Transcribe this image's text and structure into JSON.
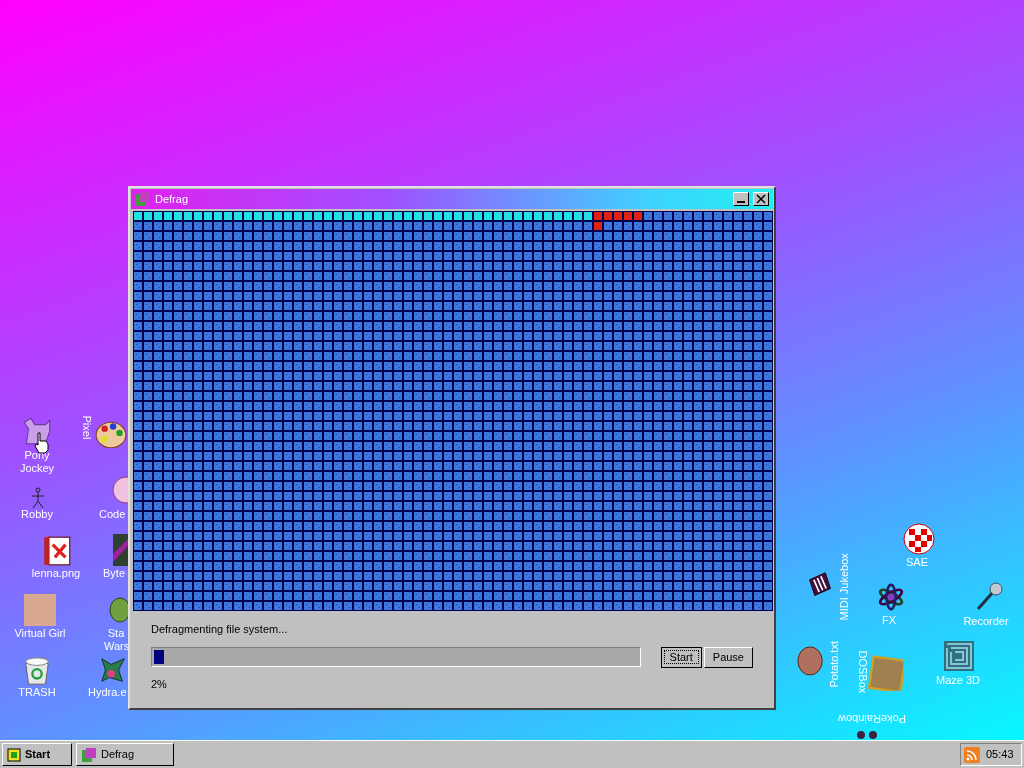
{
  "desktop_icons": [
    {
      "label": "Pony\nJockey",
      "kind": "horizontal"
    },
    {
      "label": "Pixel",
      "kind": "down"
    },
    {
      "label": "Robby",
      "kind": "horizontal"
    },
    {
      "label": "Code",
      "kind": "horizontal"
    },
    {
      "label": "lenna.png",
      "kind": "horizontal"
    },
    {
      "label": "Byte",
      "kind": "horizontal"
    },
    {
      "label": "Virtual Girl",
      "kind": "horizontal"
    },
    {
      "label": "Sta\nWars",
      "kind": "horizontal"
    },
    {
      "label": "TRASH",
      "kind": "horizontal"
    },
    {
      "label": "Hydra.e",
      "kind": "horizontal"
    },
    {
      "label": "SAE",
      "kind": "horizontal"
    },
    {
      "label": "MIDI Jukebox",
      "kind": "up"
    },
    {
      "label": "FX",
      "kind": "horizontal"
    },
    {
      "label": "Recorder",
      "kind": "horizontal"
    },
    {
      "label": "Potato.txt",
      "kind": "up"
    },
    {
      "label": "DOSBox",
      "kind": "down"
    },
    {
      "label": "Maze 3D",
      "kind": "horizontal"
    },
    {
      "label": "PokeRainbow",
      "kind": "upside_down"
    }
  ],
  "window": {
    "title": "Defrag",
    "status": "Defragmenting file system...",
    "progress": {
      "level": 0.02,
      "reading": "2%"
    },
    "buttons": [
      {
        "label": "Start",
        "focused": true
      },
      {
        "label": "Pause",
        "focused": false
      }
    ]
  },
  "taskbar": {
    "start_label": "Start",
    "tasks": [
      {
        "label": "Defrag",
        "selected": false
      }
    ],
    "clock": "05:43"
  }
}
